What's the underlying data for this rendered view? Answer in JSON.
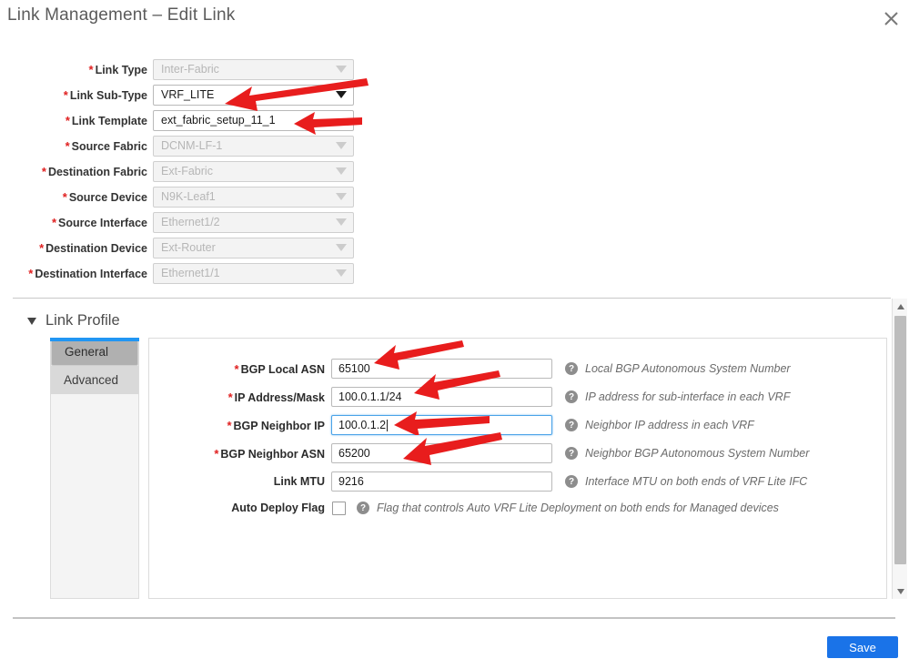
{
  "header": {
    "title": "Link Management – Edit Link",
    "close_icon": "close-x-icon"
  },
  "top_form": {
    "rows": [
      {
        "label": "Link Type",
        "required": true,
        "value": "Inter-Fabric",
        "control": "dropdown",
        "enabled": false
      },
      {
        "label": "Link Sub-Type",
        "required": true,
        "value": "VRF_LITE",
        "control": "dropdown",
        "enabled": true
      },
      {
        "label": "Link Template",
        "required": true,
        "value": "ext_fabric_setup_11_1",
        "control": "text",
        "enabled": true
      },
      {
        "label": "Source Fabric",
        "required": true,
        "value": "DCNM-LF-1",
        "control": "dropdown",
        "enabled": false
      },
      {
        "label": "Destination Fabric",
        "required": true,
        "value": "Ext-Fabric",
        "control": "dropdown",
        "enabled": false
      },
      {
        "label": "Source Device",
        "required": true,
        "value": "N9K-Leaf1",
        "control": "dropdown",
        "enabled": false
      },
      {
        "label": "Source Interface",
        "required": true,
        "value": "Ethernet1/2",
        "control": "dropdown",
        "enabled": false
      },
      {
        "label": "Destination Device",
        "required": true,
        "value": "Ext-Router",
        "control": "dropdown",
        "enabled": false
      },
      {
        "label": "Destination Interface",
        "required": true,
        "value": "Ethernet1/1",
        "control": "dropdown",
        "enabled": false
      }
    ]
  },
  "link_profile": {
    "section_title": "Link Profile",
    "collapse_icon": "triangle-down-icon",
    "tabs": [
      {
        "label": "General",
        "selected": true
      },
      {
        "label": "Advanced",
        "selected": false
      }
    ],
    "fields": [
      {
        "label": "BGP Local ASN",
        "required": true,
        "value": "65100",
        "help": "Local BGP Autonomous System Number",
        "type": "text",
        "focused": false
      },
      {
        "label": "IP Address/Mask",
        "required": true,
        "value": "100.0.1.1/24",
        "help": "IP address for sub-interface in each VRF",
        "type": "text",
        "focused": false
      },
      {
        "label": "BGP Neighbor IP",
        "required": true,
        "value": "100.0.1.2",
        "help": "Neighbor IP address in each VRF",
        "type": "text",
        "focused": true
      },
      {
        "label": "BGP Neighbor ASN",
        "required": true,
        "value": "65200",
        "help": "Neighbor BGP Autonomous System Number",
        "type": "text",
        "focused": false
      },
      {
        "label": "Link MTU",
        "required": false,
        "value": "9216",
        "help": "Interface MTU on both ends of VRF Lite IFC",
        "type": "text",
        "focused": false
      },
      {
        "label": "Auto Deploy Flag",
        "required": false,
        "value": "",
        "help": "Flag that controls Auto VRF Lite Deployment on both ends for Managed devices",
        "type": "checkbox",
        "checked": false
      }
    ]
  },
  "scrollbar": {
    "up_icon": "scroll-up-arrow-icon",
    "down_icon": "scroll-down-arrow-icon"
  },
  "footer": {
    "save_label": "Save"
  },
  "annotations": {
    "arrow_color": "#e81d1d",
    "arrows": [
      {
        "target": "link-sub-type-field"
      },
      {
        "target": "link-template-field"
      },
      {
        "target": "bgp-local-asn-field"
      },
      {
        "target": "ip-address-mask-field"
      },
      {
        "target": "bgp-neighbor-ip-field"
      },
      {
        "target": "bgp-neighbor-asn-field"
      }
    ]
  },
  "colors": {
    "accent_blue": "#1a73e8",
    "tab_accent": "#2196f3",
    "required_red": "#e02020",
    "arrow_red": "#e81d1d"
  }
}
